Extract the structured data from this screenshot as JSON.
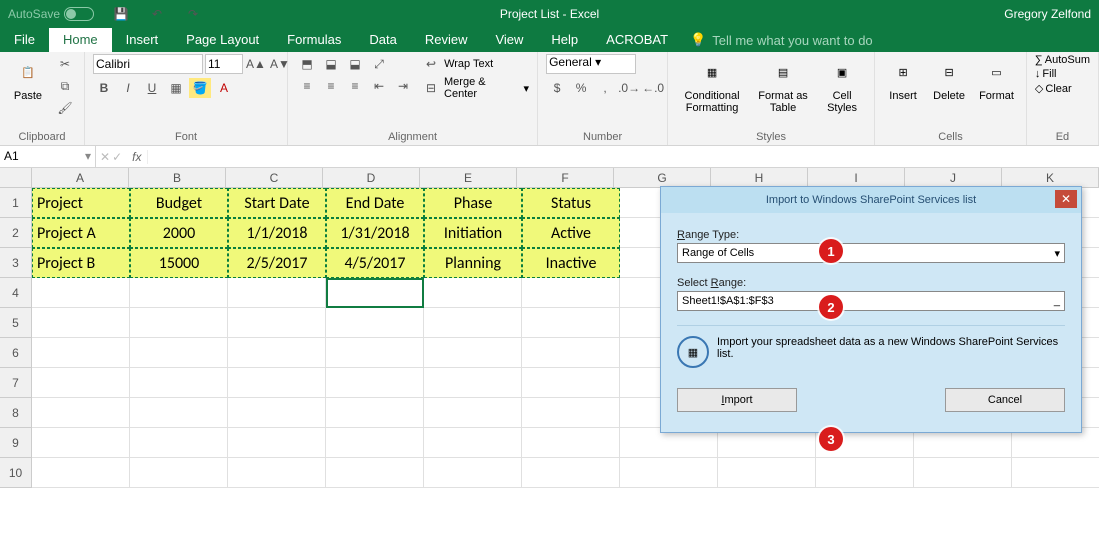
{
  "titlebar": {
    "autosave": "AutoSave",
    "title": "Project List  -  Excel",
    "user": "Gregory Zelfond"
  },
  "tabs": [
    "File",
    "Home",
    "Insert",
    "Page Layout",
    "Formulas",
    "Data",
    "Review",
    "View",
    "Help",
    "ACROBAT"
  ],
  "tellme": "Tell me what you want to do",
  "ribbon": {
    "clipboard": {
      "paste": "Paste",
      "label": "Clipboard"
    },
    "font": {
      "name": "Calibri",
      "size": "11",
      "label": "Font",
      "bold": "B",
      "italic": "I",
      "underline": "U"
    },
    "alignment": {
      "wrap": "Wrap Text",
      "merge": "Merge & Center",
      "label": "Alignment"
    },
    "number": {
      "format": "General",
      "label": "Number"
    },
    "styles": {
      "cond": "Conditional Formatting",
      "table": "Format as Table",
      "cell": "Cell Styles",
      "label": "Styles"
    },
    "cells": {
      "insert": "Insert",
      "delete": "Delete",
      "format": "Format",
      "label": "Cells"
    },
    "editing": {
      "sum": "AutoSum",
      "fill": "Fill",
      "clear": "Clear",
      "label": "Ed"
    }
  },
  "namebox": "A1",
  "sheet": {
    "cols": [
      "A",
      "B",
      "C",
      "D",
      "E",
      "F",
      "G",
      "H",
      "I",
      "J",
      "K"
    ],
    "rows": [
      "1",
      "2",
      "3",
      "4",
      "5",
      "6",
      "7",
      "8",
      "9",
      "10"
    ],
    "data": [
      [
        "Project",
        "Budget",
        "Start Date",
        "End Date",
        "Phase",
        "Status"
      ],
      [
        "Project A",
        "2000",
        "1/1/2018",
        "1/31/2018",
        "Initiation",
        "Active"
      ],
      [
        "Project B",
        "15000",
        "2/5/2017",
        "4/5/2017",
        "Planning",
        "Inactive"
      ]
    ]
  },
  "dialog": {
    "title": "Import to Windows SharePoint Services list",
    "range_type_label": "Range Type:",
    "range_type_value": "Range of Cells",
    "select_range_label": "Select Range:",
    "select_range_value": "Sheet1!$A$1:$F$3",
    "info": "Import your spreadsheet data as a new Windows SharePoint Services list.",
    "import": "Import",
    "cancel": "Cancel",
    "callouts": {
      "one": "1",
      "two": "2",
      "three": "3"
    }
  }
}
